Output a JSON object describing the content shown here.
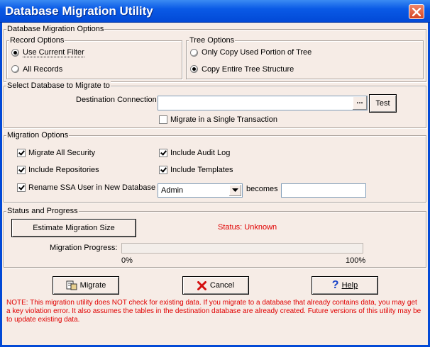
{
  "window": {
    "title": "Database Migration Utility"
  },
  "options": {
    "group_label": "Database Migration Options",
    "record_options": {
      "label": "Record Options",
      "items": [
        {
          "label": "Use Current Filter",
          "selected": true
        },
        {
          "label": "All Records",
          "selected": false
        }
      ]
    },
    "tree_options": {
      "label": "Tree Options",
      "items": [
        {
          "label": "Only Copy Used Portion of Tree",
          "selected": false
        },
        {
          "label": "Copy Entire Tree Structure",
          "selected": true
        }
      ]
    }
  },
  "select_db": {
    "label": "Select Database to Migrate to",
    "dest_label": "Destination Connection",
    "dest_value": "",
    "browse_label": "...",
    "test_label": "Test",
    "single_txn_label": "Migrate in a Single Transaction",
    "single_txn_checked": false
  },
  "migration_options": {
    "label": "Migration Options",
    "items": [
      {
        "label": "Migrate All Security",
        "checked": true
      },
      {
        "label": "Include Audit Log",
        "checked": true
      },
      {
        "label": "Include Repositories",
        "checked": true
      },
      {
        "label": "Include Templates",
        "checked": true
      },
      {
        "label": "Rename SSA User in New Database",
        "checked": true
      }
    ],
    "rename_from": "Admin",
    "becomes_label": "becomes",
    "rename_to": ""
  },
  "status": {
    "label": "Status and Progress",
    "estimate_label": "Estimate Migration Size",
    "status_text": "Status: Unknown",
    "progress_label": "Migration Progress:",
    "progress_value": 0,
    "min_label": "0%",
    "max_label": "100%"
  },
  "buttons": {
    "migrate": "Migrate",
    "cancel": "Cancel",
    "help": "Help"
  },
  "note": "NOTE: This migration utility does NOT check for existing data.  If you migrate to a database that already contains data, you may get a key violation error.  It also assumes the tables in the destination database are already created.  Future versions of this utility may be to update existing data.",
  "colors": {
    "title_bar": "#0249D6",
    "status_text": "#E00000",
    "note_text": "#E00000"
  }
}
